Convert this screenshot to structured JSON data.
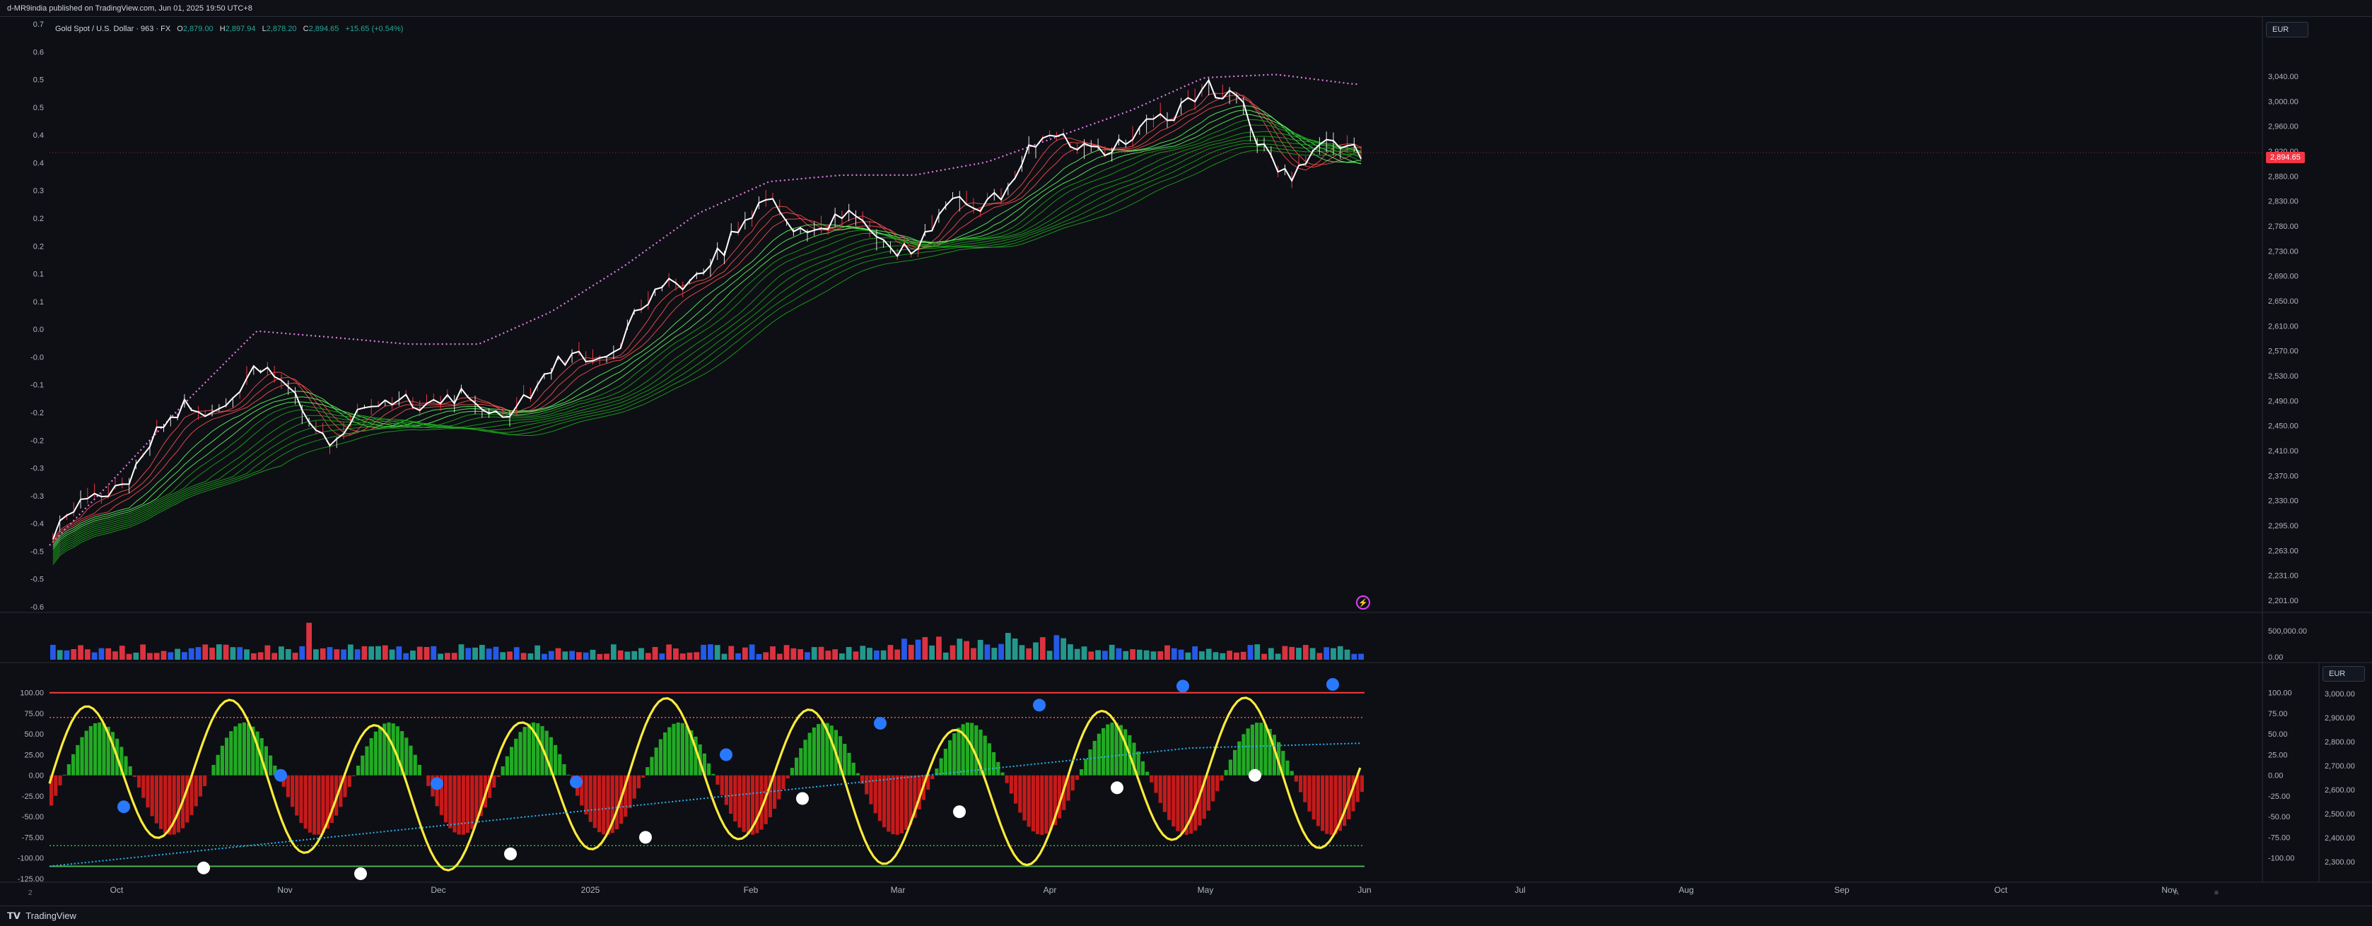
{
  "header": {
    "published": "d-MR9india published on TradingView.com, Jun 01, 2025 19:50 UTC+8"
  },
  "legend": {
    "symbol": "Gold Spot / U.S. Dollar · 963 · FX",
    "o_label": "O",
    "o": "2,879.00",
    "h_label": "H",
    "h": "2,897.94",
    "l_label": "L",
    "l": "2,878.20",
    "c_label": "C",
    "c": "2,894.65",
    "change": "+15.65 (+0.54%)"
  },
  "currency_label": "EUR",
  "price_flag": "2,894.65",
  "footer": {
    "brand": "TradingView"
  },
  "colors": {
    "bg": "#0d0f14",
    "up": "#26a69a",
    "down": "#f23645",
    "ribbon": "#2bd12b",
    "osc": "#ffeb3b",
    "envelope": "#e07be0",
    "signal": "#29b6f6"
  },
  "chart_data": [
    {
      "type": "candlestick",
      "title": "Gold Spot / U.S. Dollar",
      "x": [
        "2024-09-20",
        "2024-10-01",
        "2024-10-15",
        "2024-10-30",
        "2024-11-14",
        "2024-11-28",
        "2024-12-12",
        "2024-12-26",
        "2025-01-09",
        "2025-01-23",
        "2025-02-06",
        "2025-02-20",
        "2025-03-06",
        "2025-03-20",
        "2025-04-03",
        "2025-04-17",
        "2025-05-01",
        "2025-05-15",
        "2025-05-30"
      ],
      "close": [
        2300,
        2380,
        2480,
        2560,
        2460,
        2530,
        2490,
        2550,
        2620,
        2720,
        2810,
        2780,
        2760,
        2830,
        2920,
        2900,
        3010,
        2880,
        2894.65
      ],
      "envelope_upper": [
        2290,
        2380,
        2500,
        2620,
        2610,
        2600,
        2600,
        2650,
        2720,
        2800,
        2850,
        2860,
        2860,
        2880,
        2920,
        2960,
        3010,
        3015,
        3000
      ],
      "x_tick_labels": [
        "Oct",
        "Nov",
        "Dec",
        "2025",
        "Feb",
        "Mar",
        "Apr",
        "May",
        "Jun",
        "Jul",
        "Aug",
        "Sep",
        "Oct",
        "Nov"
      ],
      "right_axis_ticks": [
        "3,040.00",
        "3,000.00",
        "2,960.00",
        "2,920.00",
        "2,880.00",
        "2,830.00",
        "2,780.00",
        "2,730.00",
        "2,690.00",
        "2,650.00",
        "2,610.00",
        "2,570.00",
        "2,530.00",
        "2,490.00",
        "2,450.00",
        "2,410.00",
        "2,370.00",
        "2,330.00",
        "2,295.00",
        "2,263.00",
        "2,231.00",
        "2,201.00"
      ],
      "left_axis_ticks": [
        "0.7",
        "0.6",
        "0.5",
        "0.5",
        "0.4",
        "0.4",
        "0.3",
        "0.2",
        "0.2",
        "0.1",
        "0.1",
        "0.0",
        "-0.0",
        "-0.1",
        "-0.2",
        "-0.2",
        "-0.3",
        "-0.3",
        "-0.4",
        "-0.5",
        "-0.5",
        "-0.6"
      ],
      "ylim": [
        2201,
        3060
      ]
    },
    {
      "type": "bar",
      "title": "Volume",
      "right_axis_ticks": [
        "500,000.00",
        "0.00"
      ]
    },
    {
      "type": "line",
      "title": "Oscillator",
      "left_axis_ticks": [
        "100.00",
        "75.00",
        "50.00",
        "25.00",
        "0.00",
        "-25.00",
        "-50.00",
        "-75.00",
        "-100.00",
        "-125.00"
      ],
      "right_axis_ticks": [
        "100.00",
        "75.00",
        "50.00",
        "25.00",
        "0.00",
        "-25.00",
        "-50.00",
        "-75.00",
        "-100.00"
      ],
      "far_right_axis_ticks": [
        "3,000.00",
        "2,900.00",
        "2,800.00",
        "2,700.00",
        "2,600.00",
        "2,500.00",
        "2,400.00",
        "2,300.00"
      ],
      "levels": {
        "upper": 100,
        "upper_dotted": 70,
        "lower_dotted": -85,
        "lower": -110
      },
      "ylim": [
        -125,
        110
      ],
      "blue_dots": [
        [
          -38
        ],
        [
          0
        ],
        [
          -10
        ],
        [
          -8
        ],
        [
          25
        ],
        [
          63
        ],
        [
          85
        ],
        [
          108
        ],
        [
          110
        ]
      ],
      "white_dots": [
        [
          -112
        ],
        [
          -119
        ],
        [
          -95
        ],
        [
          -75
        ],
        [
          -28
        ],
        [
          -44
        ],
        [
          -15
        ],
        [
          0
        ]
      ]
    }
  ]
}
